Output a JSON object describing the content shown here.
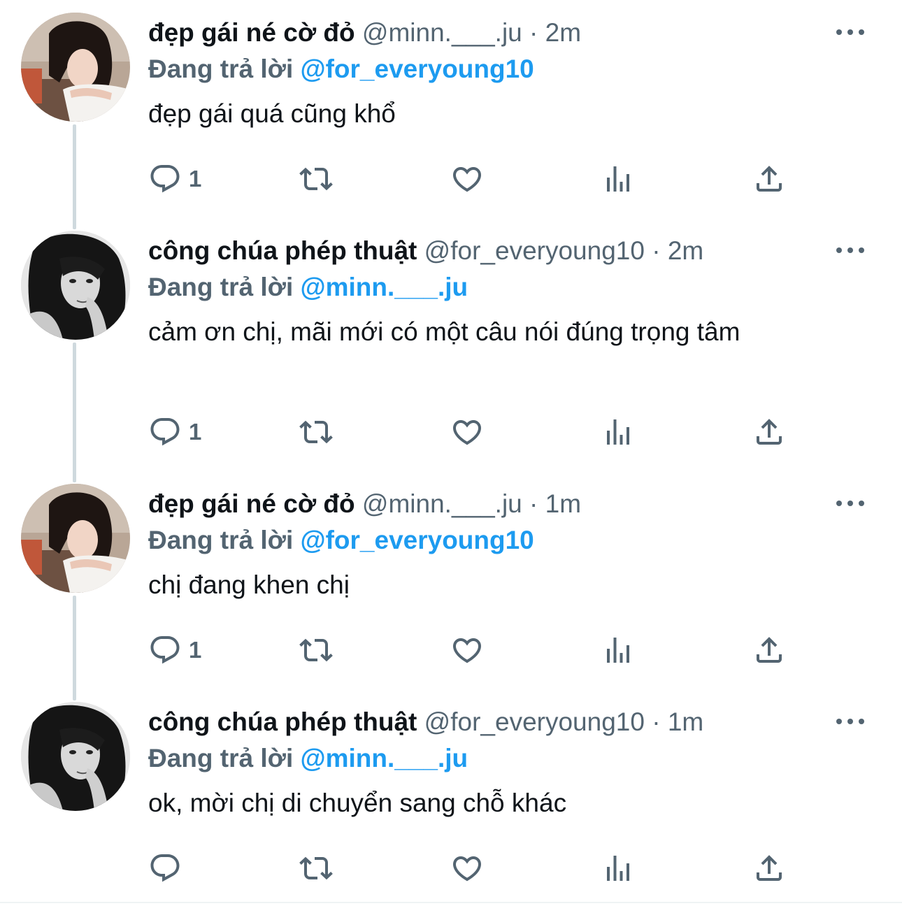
{
  "colors": {
    "accent": "#1d9bf0",
    "secondary_text": "#536471",
    "primary_text": "#0f1419",
    "thread_line": "#cfd9de"
  },
  "reply_prefix": "Đang trả lời",
  "tweets": [
    {
      "display_name": "đẹp gái né cờ đỏ",
      "handle": "@minn.___.ju",
      "separator": "·",
      "time": "2m",
      "reply_to": "@for_everyoung10",
      "text": "đẹp gái quá cũng khổ",
      "reply_count": "1",
      "avatar": "avatar-girl-resting-on-arms"
    },
    {
      "display_name": "công chúa phép thuật",
      "handle": "@for_everyoung10",
      "separator": "·",
      "time": "2m",
      "reply_to": "@minn.___.ju",
      "text": "cảm ơn chị, mãi mới có một câu nói đúng trọng tâm",
      "reply_count": "1",
      "avatar": "avatar-girl-black-and-white"
    },
    {
      "display_name": "đẹp gái né cờ đỏ",
      "handle": "@minn.___.ju",
      "separator": "·",
      "time": "1m",
      "reply_to": "@for_everyoung10",
      "text": "chị đang khen chị",
      "reply_count": "1",
      "avatar": "avatar-girl-resting-on-arms"
    },
    {
      "display_name": "công chúa phép thuật",
      "handle": "@for_everyoung10",
      "separator": "·",
      "time": "1m",
      "reply_to": "@minn.___.ju",
      "text": "ok, mời chị di chuyển sang chỗ khác",
      "reply_count": "",
      "avatar": "avatar-girl-black-and-white"
    }
  ],
  "icons": {
    "reply": "reply-icon",
    "retweet": "retweet-icon",
    "like": "heart-icon",
    "views": "views-chart-icon",
    "share": "share-icon",
    "more": "more-dots-icon"
  }
}
